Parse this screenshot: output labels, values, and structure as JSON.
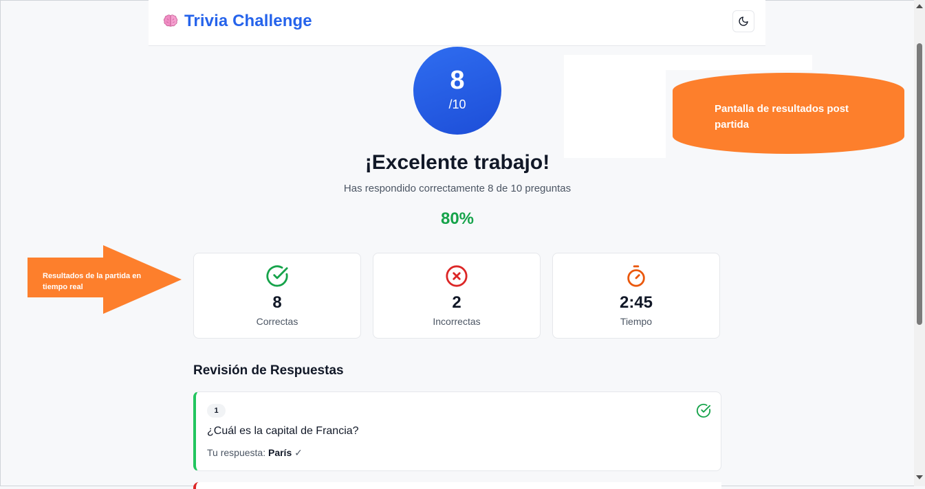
{
  "app": {
    "title": "Trivia Challenge",
    "brand_icon": "brain-icon",
    "theme_icon": "moon-icon"
  },
  "score": {
    "value": "8",
    "total": "/10"
  },
  "result": {
    "headline": "¡Excelente trabajo!",
    "subline": "Has respondido correctamente 8 de 10 preguntas",
    "percent": "80%",
    "percent_color": "#16a34a"
  },
  "stats": [
    {
      "icon": "check-circle-icon",
      "value": "8",
      "label": "Correctas",
      "color": "#16a34a"
    },
    {
      "icon": "x-circle-icon",
      "value": "2",
      "label": "Incorrectas",
      "color": "#dc2626"
    },
    {
      "icon": "stopwatch-icon",
      "value": "2:45",
      "label": "Tiempo",
      "color": "#ea580c"
    }
  ],
  "review": {
    "title": "Revisión de Respuestas",
    "items": [
      {
        "number": "1",
        "question": "¿Cuál es la capital de Francia?",
        "answer_prefix": "Tu respuesta:",
        "answer": "París",
        "answer_mark": "✓",
        "status_icon": "check-circle-icon",
        "accent": "#22c55e"
      }
    ]
  },
  "annotations": {
    "callout": "Pantalla de resultados post partida",
    "arrow": "Resultados de la partida en tiempo real",
    "color": "#fd7f2c"
  }
}
